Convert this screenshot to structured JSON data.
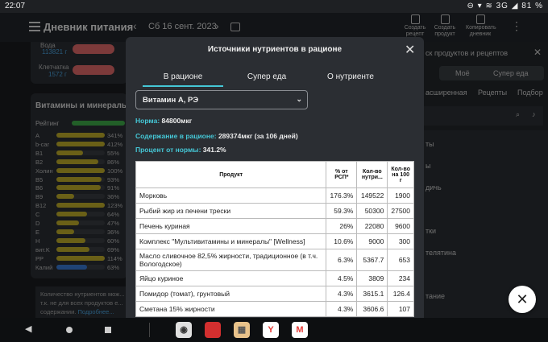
{
  "status_bar": {
    "time": "22:07",
    "system": "⊖ ▾ ≋ 3G ◢ 81 %"
  },
  "app_bar": {
    "title": "Дневник питания",
    "prev_label": "‹",
    "date": "Сб 16 сент. 2023",
    "next_label": "›",
    "tools": [
      {
        "label": "Создать рецепт"
      },
      {
        "label": "Создать продукт"
      },
      {
        "label": "Копировать дневник"
      }
    ],
    "more_label": "⋮"
  },
  "background_left": {
    "water_label": "Вода",
    "water_value": "113821 г",
    "fiber_label": "Клетчатка",
    "fiber_value": "1572 г",
    "vitamins_title": "Витамины и минералы",
    "rating_label": "Рейтинг",
    "rows": [
      {
        "name": "A",
        "pct": "341%",
        "fill": 1.0,
        "color": "#c2b02a"
      },
      {
        "name": "b-car",
        "pct": "412%",
        "fill": 1.0,
        "color": "#c2b02a"
      },
      {
        "name": "B1",
        "pct": "55%",
        "fill": 0.55,
        "color": "#c2b02a"
      },
      {
        "name": "B2",
        "pct": "86%",
        "fill": 0.86,
        "color": "#c2b02a"
      },
      {
        "name": "Холин",
        "pct": "100%",
        "fill": 1.0,
        "color": "#c2b02a"
      },
      {
        "name": "B5",
        "pct": "93%",
        "fill": 0.93,
        "color": "#c2b02a"
      },
      {
        "name": "B6",
        "pct": "91%",
        "fill": 0.91,
        "color": "#c2b02a"
      },
      {
        "name": "B9",
        "pct": "36%",
        "fill": 0.36,
        "color": "#c2b02a"
      },
      {
        "name": "B12",
        "pct": "123%",
        "fill": 1.0,
        "color": "#c2b02a"
      },
      {
        "name": "C",
        "pct": "64%",
        "fill": 0.64,
        "color": "#c2b02a"
      },
      {
        "name": "D",
        "pct": "47%",
        "fill": 0.47,
        "color": "#c2b02a"
      },
      {
        "name": "E",
        "pct": "36%",
        "fill": 0.36,
        "color": "#c2b02a"
      },
      {
        "name": "H",
        "pct": "60%",
        "fill": 0.6,
        "color": "#c2b02a"
      },
      {
        "name": "вит.K",
        "pct": "69%",
        "fill": 0.69,
        "color": "#c2b02a"
      },
      {
        "name": "PP",
        "pct": "114%",
        "fill": 1.0,
        "color": "#c2b02a"
      },
      {
        "name": "Калий",
        "pct": "63%",
        "fill": 0.63,
        "color": "#3a7bd5"
      }
    ],
    "note_text": "Количество нутриентов мож... т.к. не для всех продуктов е... содержании.",
    "note_link": "Подробнее..."
  },
  "background_right": {
    "search_placeholder": "ск продуктов и рецептов",
    "tab_mine": "Моё",
    "tab_super": "Супер еда",
    "sub_tabs": [
      "асширенная",
      "Рецепты",
      "Подбор"
    ],
    "list_items": [
      "ты",
      "ы",
      "дичь",
      "тки",
      "телятина",
      "тание"
    ]
  },
  "modal": {
    "title": "Источники нутриентов в рационе",
    "tabs": [
      "В рационе",
      "Супер еда",
      "О нутриенте"
    ],
    "select_value": "Витамин А, РЭ",
    "norm_label": "Норма:",
    "norm_value": "84800мкг",
    "content_label": "Содержание в рационе:",
    "content_value": "289374мкг (за 106 дней)",
    "percent_label": "Процент от нормы:",
    "percent_value": "341.2%",
    "table": {
      "headers": [
        "Продукт",
        "% от РСП*",
        "Кол-во нутри...",
        "Кол-во на 100 г"
      ],
      "rows": [
        {
          "product": "Морковь",
          "pct": "176.3%",
          "amount": "149522",
          "per100": "1900",
          "tall": false
        },
        {
          "product": "Рыбий жир из печени трески",
          "pct": "59.3%",
          "amount": "50300",
          "per100": "27500",
          "tall": false
        },
        {
          "product": "Печень куриная",
          "pct": "26%",
          "amount": "22080",
          "per100": "9600",
          "tall": false
        },
        {
          "product": "Комплекс \"Мультивитамины и минералы\" [Wellness]",
          "pct": "10.6%",
          "amount": "9000",
          "per100": "300",
          "tall": false
        },
        {
          "product": "Масло сливочное 82,5% жирности, традиционное (в т.ч. Вологодское)",
          "pct": "6.3%",
          "amount": "5367.7",
          "per100": "653",
          "tall": true
        },
        {
          "product": "Яйцо куриное",
          "pct": "4.5%",
          "amount": "3809",
          "per100": "234",
          "tall": false
        },
        {
          "product": "Помидор (томат), грунтовый",
          "pct": "4.3%",
          "amount": "3615.1",
          "per100": "126.4",
          "tall": false
        },
        {
          "product": "Сметана 15% жирности",
          "pct": "4.3%",
          "amount": "3606.6",
          "per100": "107",
          "tall": false
        }
      ]
    },
    "close_label": "✕"
  },
  "fab_label": "✕",
  "navbar": {
    "back": "◀",
    "dock_apps": [
      {
        "name": "camera",
        "label": "◉",
        "bg": "#e0e0e0",
        "fg": "#333"
      },
      {
        "name": "pdf",
        "label": "",
        "bg": "#d32f2f",
        "fg": "#fff"
      },
      {
        "name": "notes",
        "label": "▦",
        "bg": "#e8c28a",
        "fg": "#555"
      },
      {
        "name": "yandex",
        "label": "Y",
        "bg": "#ffffff",
        "fg": "#e53935"
      },
      {
        "name": "gmail",
        "label": "M",
        "bg": "#ffffff",
        "fg": "#e53935"
      }
    ]
  }
}
